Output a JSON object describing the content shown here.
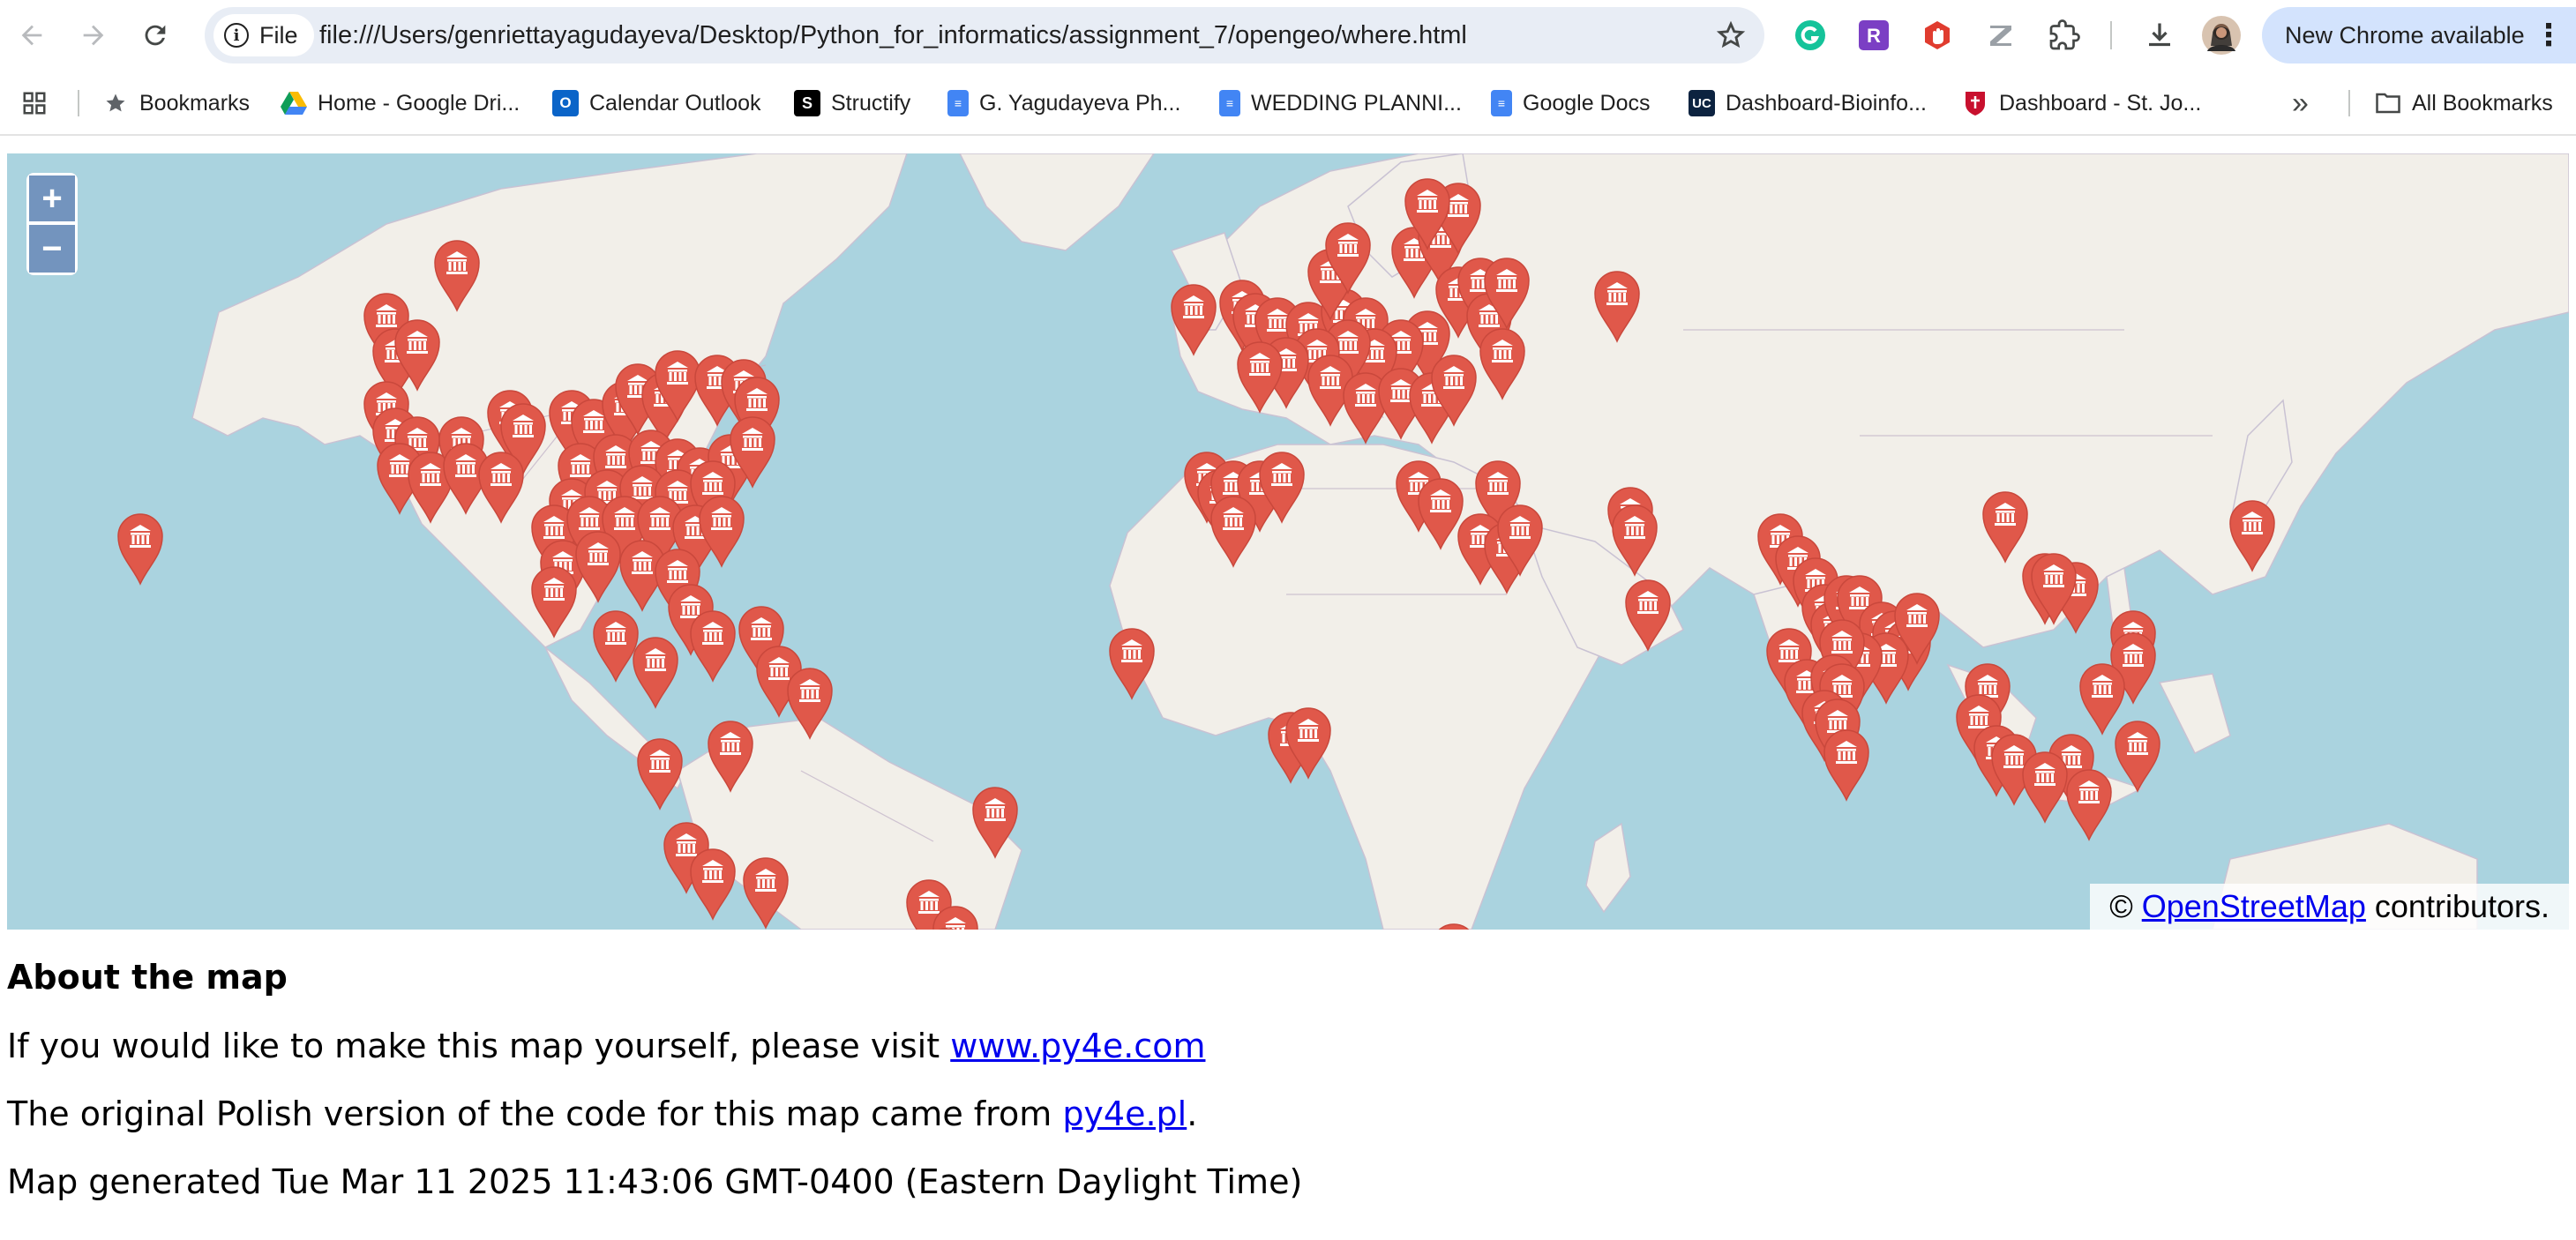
{
  "browser": {
    "url_chip": "File",
    "url": "file:///Users/genriettayagudayeva/Desktop/Python_for_informatics/assignment_7/opengeo/where.html",
    "update_button": "New Chrome available",
    "extensions": [
      "grammarly-icon",
      "r-extension-icon",
      "hand-extension-icon",
      "z-extension-icon",
      "puzzle-icon"
    ]
  },
  "bookmarks": {
    "items": [
      {
        "label": "Bookmarks",
        "icon": "star-icon"
      },
      {
        "label": "Home - Google Dri...",
        "icon": "google-drive-icon"
      },
      {
        "label": "Calendar Outlook",
        "icon": "outlook-icon"
      },
      {
        "label": "Structify",
        "icon": "structify-icon"
      },
      {
        "label": "G. Yagudayeva Ph...",
        "icon": "google-docs-icon"
      },
      {
        "label": "WEDDING PLANNI...",
        "icon": "google-docs-icon"
      },
      {
        "label": "Google Docs",
        "icon": "google-docs-icon"
      },
      {
        "label": "Dashboard-Bioinfo...",
        "icon": "uc-icon"
      },
      {
        "label": "Dashboard - St. Jo...",
        "icon": "st-johns-icon"
      }
    ],
    "overflow": "»",
    "all_bookmarks": "All Bookmarks"
  },
  "map": {
    "zoom_in": "+",
    "zoom_out": "−",
    "attribution_prefix": "©",
    "attribution_link": "OpenStreetMap",
    "attribution_suffix": "contributors.",
    "marker_color": "#e0584a",
    "water_color": "#aad3df",
    "land_color": "#f2efe9"
  },
  "about": {
    "heading": "About the map",
    "line1_text": "If you would like to make this map yourself, please visit",
    "line1_link": "www.py4e.com",
    "line2_text": "The original Polish version of the code for this map came from",
    "line2_link": "py4e.pl",
    "line2_end": ".",
    "line3": "Map generated Tue Mar 11 2025 11:43:06 GMT-0400 (Eastern Daylight Time)"
  }
}
